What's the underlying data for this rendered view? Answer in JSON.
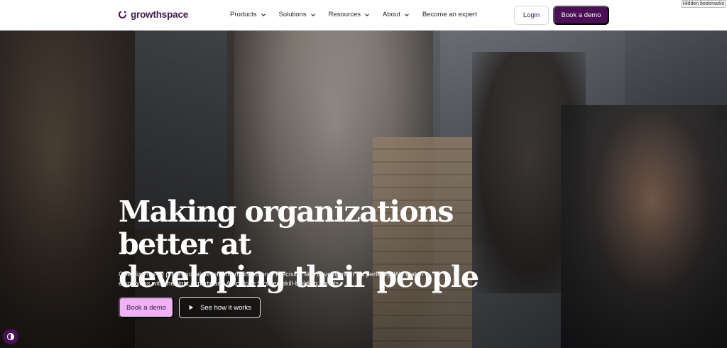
{
  "browser": {
    "hidden_bookmarks": "Hidden bookmarks"
  },
  "header": {
    "logo_text": "growthspace",
    "nav": [
      {
        "label": "Products",
        "has_dropdown": true
      },
      {
        "label": "Solutions",
        "has_dropdown": true
      },
      {
        "label": "Resources",
        "has_dropdown": true
      },
      {
        "label": "About",
        "has_dropdown": true
      },
      {
        "label": "Become an expert",
        "has_dropdown": false
      }
    ],
    "login_label": "Login",
    "book_demo_label": "Book a demo"
  },
  "hero": {
    "headline_line1": "Making organizations better at",
    "headline_line2": "developing their people",
    "subtext": "One-size-fits-all professional development fits no one. Precision skill development fits perfectly. We match employees with the right experts and AI to drive focused skill-building sprints.",
    "primary_cta": "Book a demo",
    "secondary_cta": "See how it works"
  },
  "icons": {
    "logo": "growthspace-logo-icon",
    "dropdown": "chevron-down-icon",
    "play": "play-icon",
    "accessibility": "accessibility-icon"
  },
  "colors": {
    "brand_dark": "#4a0f55",
    "brand_light": "#f0b2f4",
    "text_dark": "#3f1b4f"
  }
}
